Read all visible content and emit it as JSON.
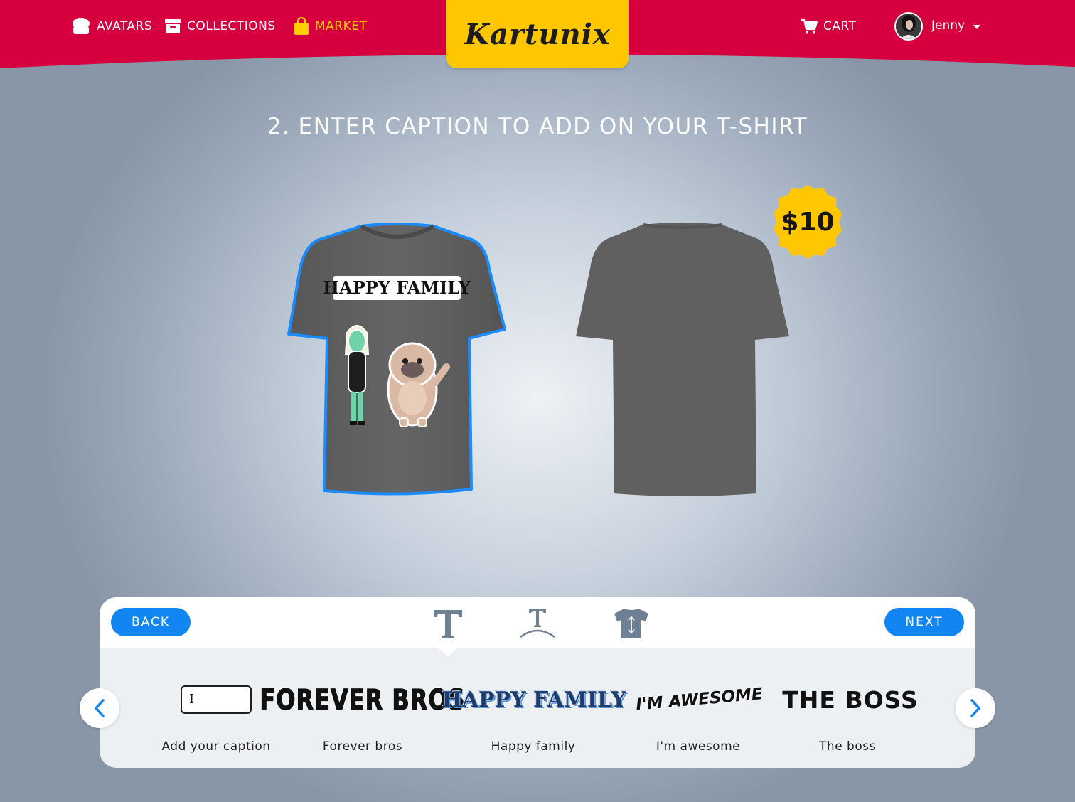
{
  "header": {
    "nav": [
      {
        "label": "AVATARS",
        "icon": "avatars-icon"
      },
      {
        "label": "COLLECTIONS",
        "icon": "archive-icon"
      },
      {
        "label": "MARKET",
        "icon": "shopping-bag-icon",
        "active": true
      }
    ],
    "logo": "Kartunix",
    "cart_label": "CART",
    "user_name": "Jenny",
    "colors": {
      "bar": "#d6003f",
      "logo_bg": "#ffc700",
      "active_nav": "#ffd000"
    }
  },
  "main": {
    "title": "2. ENTER CAPTION TO ADD ON YOUR T-SHIRT",
    "shirt_front_caption": "HAPPY FAMILY",
    "price": "$10",
    "shirt_color": "#5f5f5f",
    "selection_color": "#1a8cff"
  },
  "panel": {
    "back_label": "BACK",
    "next_label": "NEXT",
    "tools": [
      "text-style-icon",
      "text-arc-icon",
      "shirt-position-icon"
    ],
    "input_cursor": "I",
    "captions": [
      {
        "label": "Add your caption",
        "preview": ""
      },
      {
        "label": "Forever bros",
        "preview": "FOREVER BROS"
      },
      {
        "label": "Happy family",
        "preview": "HAPPY FAMILY"
      },
      {
        "label": "I'm awesome",
        "preview": "I'M AWESOME"
      },
      {
        "label": "The boss",
        "preview": "THE BOSS"
      }
    ],
    "accent": "#1185f2"
  }
}
